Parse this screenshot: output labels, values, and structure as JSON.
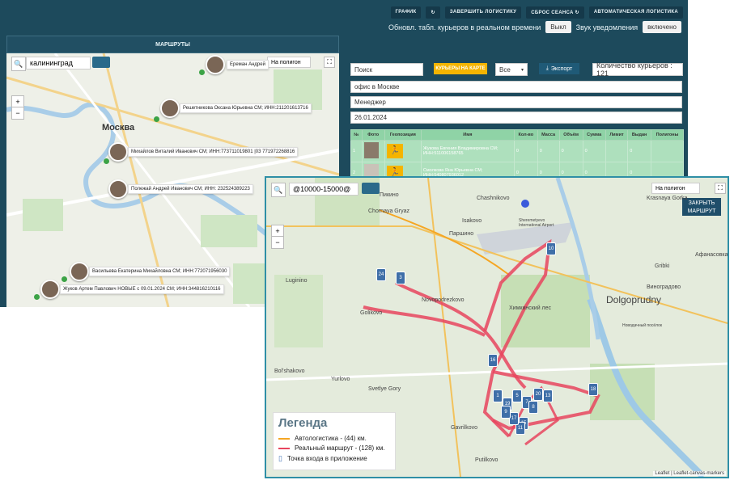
{
  "topbar": {
    "buttons": [
      "ГРАФИК",
      "↻",
      "ЗАВЕРШИТЬ ЛОГИСТИКУ",
      "СБРОС СЕАНСА ↻",
      "АВТОМАТИЧЕСКАЯ ЛОГИСТИКА"
    ]
  },
  "realtime": {
    "label": "Обновл. табл. курьеров в реальном времени",
    "toggle": "Выкл",
    "sound_label": "Звук уведомления",
    "sound_toggle": "включено"
  },
  "routes": {
    "header": "МАРШРУТЫ"
  },
  "map1": {
    "search_value": "калининград",
    "city_label": "Москва",
    "polygon_select": "На полигон",
    "couriers": [
      "Ереман Андрей",
      "Решетникова Оксана Юрьевна СМ; ИНН:211201613716",
      "Михайлов Виталий Иванович СМ; ИНН:773711019801 |03 771972268816",
      "Полежай Андрей Иванович СМ; ИНН: 232524389223",
      "Васильева Екатерина Михайловна СМ; ИНН:772071956030",
      "Жуков Артем Павлович НОВЫЕ с 09.01.2024 СМ; ИНН:344816210116"
    ]
  },
  "panel": {
    "search_placeholder": "Поиск",
    "couriers_on_map": "КУРЬЕРЫ НА КАРТЕ",
    "filter": "Все",
    "export": "Экспорт",
    "courier_count": "Количество курьеров : 121",
    "office": "офис в Москве",
    "role": "Менеджер",
    "date": "26.01.2024"
  },
  "table": {
    "headers": [
      "№",
      "Фото",
      "Геопозиция",
      "Имя",
      "Кол-во",
      "Масса",
      "Объём",
      "Сумма",
      "Лимит",
      "Выдан",
      "Полигоны"
    ],
    "rows": [
      {
        "n": "1",
        "name": "Жукова Евгения Владимировна СМ; ИНН:511006158765",
        "qty": "0",
        "mass": "0",
        "vol": "0",
        "sum": "0",
        "limit": "",
        "issued": "0",
        "poly": ""
      },
      {
        "n": "2",
        "name": "Смолкова Яна Юрьевна СМ; ИНН:540807936012",
        "qty": "0",
        "mass": "0",
        "vol": "0",
        "sum": "0",
        "limit": "",
        "issued": "0",
        "poly": ""
      }
    ]
  },
  "map2": {
    "search_value": "@10000-15000@",
    "polygon_select": "На полигон",
    "close_route": "ЗАКРЫТЬ МАРШРУТ",
    "labels": [
      "Chashnikovo",
      "Isakovo",
      "Пикино",
      "Chornaya Gryaz",
      "Паршино",
      "Lugininо",
      "Golikovo",
      "Novopodrezkovo",
      "Химкинский лес",
      "Dolgoprudny",
      "Виноградово",
      "Gribki",
      "Bol'shakovo",
      "Yurlovo",
      "Svetlye Gory",
      "Gavrilkovo",
      "Putilkovo",
      "Sheremetyevo International Airport",
      "Krasnaya Gorka",
      "Афанасовка",
      "Новодачный посёлок"
    ],
    "attribution": "Leaflet | Leaflet-canvas-markers",
    "markers": [
      "24",
      "3",
      "16",
      "10",
      "18",
      "1",
      "19",
      "5",
      "7",
      "8",
      "20",
      "13",
      "15",
      "11",
      "17",
      "9"
    ]
  },
  "legend": {
    "title": "Легенда",
    "items": [
      {
        "label": "Автологистика - (44) км.",
        "color": "#f5a623"
      },
      {
        "label": "Реальный маршрут - (128) км.",
        "color": "#e8455e"
      },
      {
        "label": "Точка входа в приложение",
        "color": "#4a79b8"
      }
    ]
  }
}
